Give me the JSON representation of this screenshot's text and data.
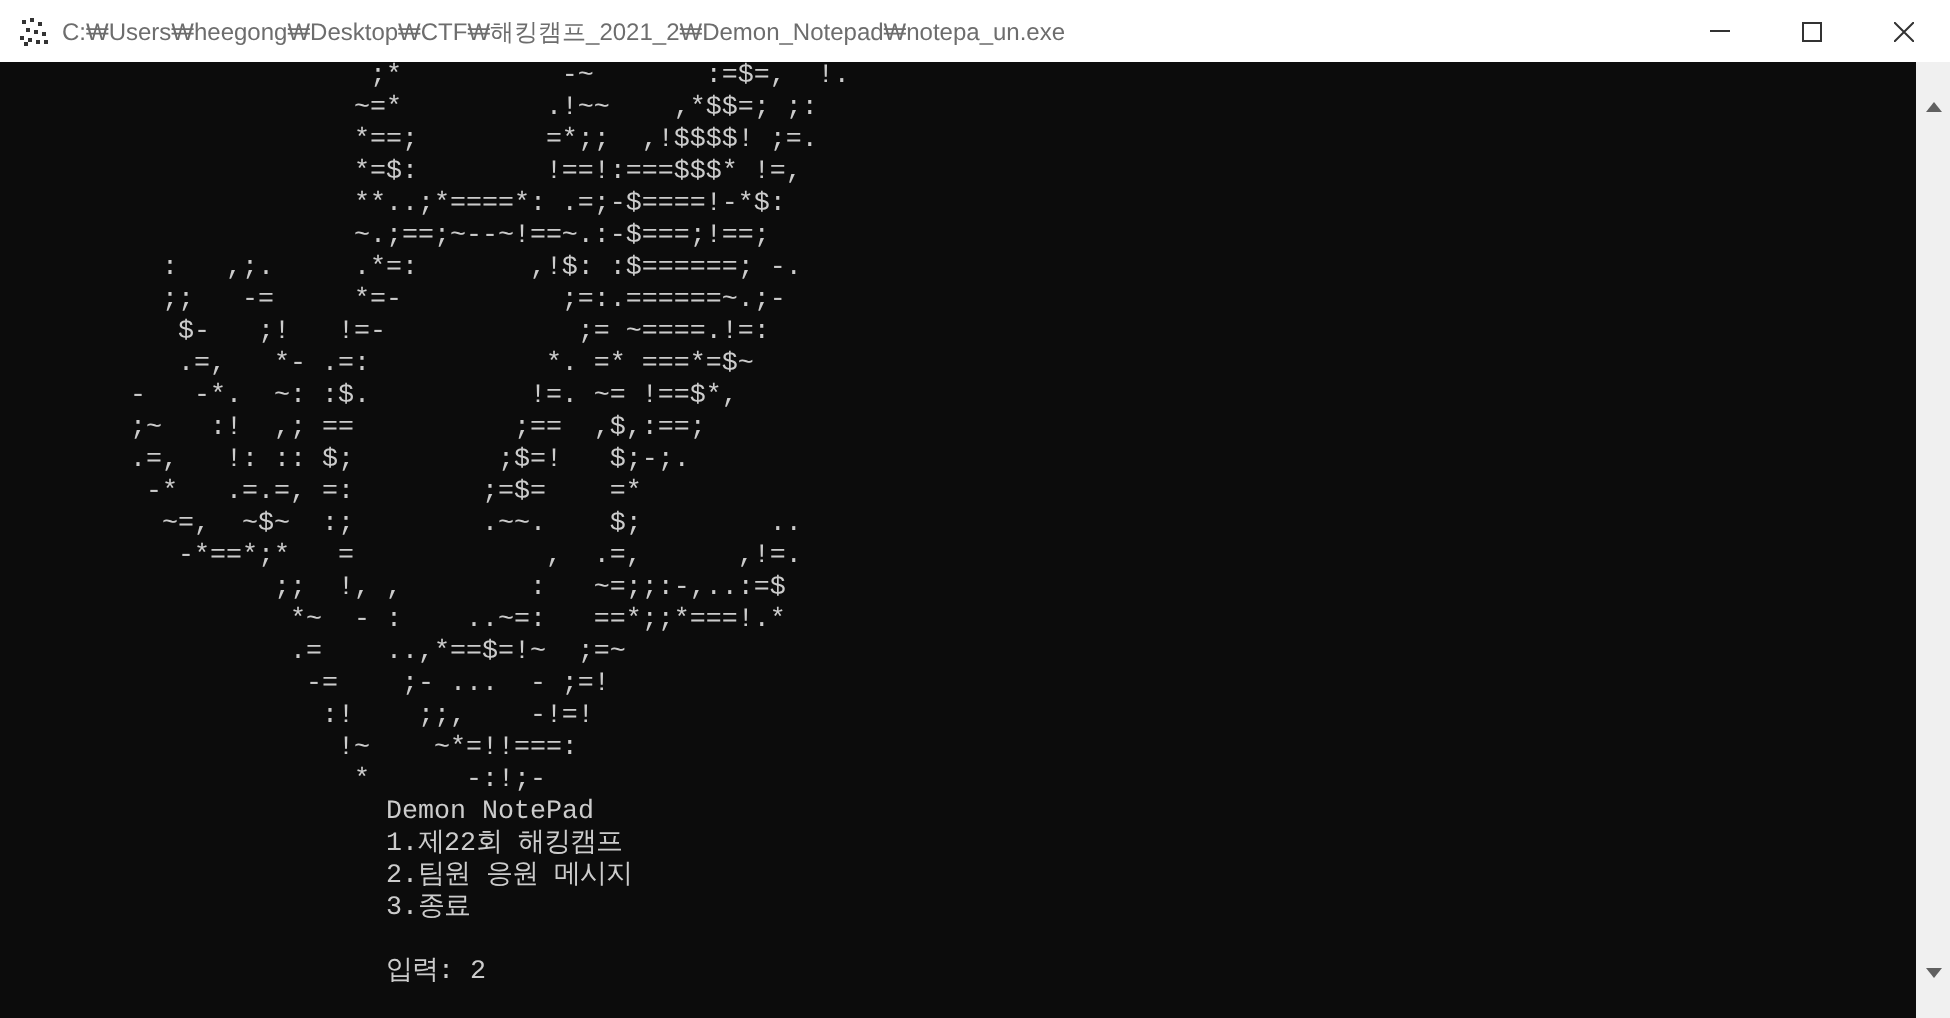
{
  "window": {
    "title": "C:₩Users₩heegong₩Desktop₩CTF₩해킹캠프_2021_2₩Demon_Notepad₩notepa_un.exe"
  },
  "console": {
    "art_lines": [
      "                       ;*          -~       :=$=,  !.",
      "                      ~=*         .!~~    ,*$$=; ;:",
      "                      *==;        =*;;  ,!$$$$! ;=.",
      "                      *=$:        !==!:===$$$* !=,",
      "                      **..;*====*: .=;-$====!-*$:",
      "                      ~.;==;~--~!==~.:-$===;!==;",
      "          :   ,;.     .*=:       ,!$: :$======; -.",
      "          ;;   -=     *=-          ;=:.======~.;-",
      "           $-   ;!   !=-            ;= ~====.!=:",
      "           .=,   *- .=:           *. =* ===*=$~",
      "        -   -*.  ~: :$.          !=. ~= !==$*,",
      "        ;~   :!  ,; ==          ;==  ,$,:==;",
      "        .=,   !: :: $;         ;$=!   $;-;.",
      "         -*   .=.=, =:        ;=$=    =*",
      "          ~=,  ~$~  :;        .~~.    $;        ..",
      "           -*==*;*   =            ,  .=,      ,!=.",
      "                 ;;  !, ,        :   ~=;;:-,..:=$",
      "                  *~  - :    ..~=:   ==*;;*===!.*",
      "                  .=    ..,*==$=!~  ;=~",
      "                   -=    ;- ...  - ;=!",
      "                    :!    ;;,    -!=!",
      "                     !~    ~*=!!===:",
      "                      *      -:!;-"
    ],
    "menu_title": "Demon NotePad",
    "menu_options": [
      "1.제22회 해킹캠프",
      "2.팀원 응원 메시지",
      "3.종료"
    ],
    "prompt": "입력: 2"
  }
}
